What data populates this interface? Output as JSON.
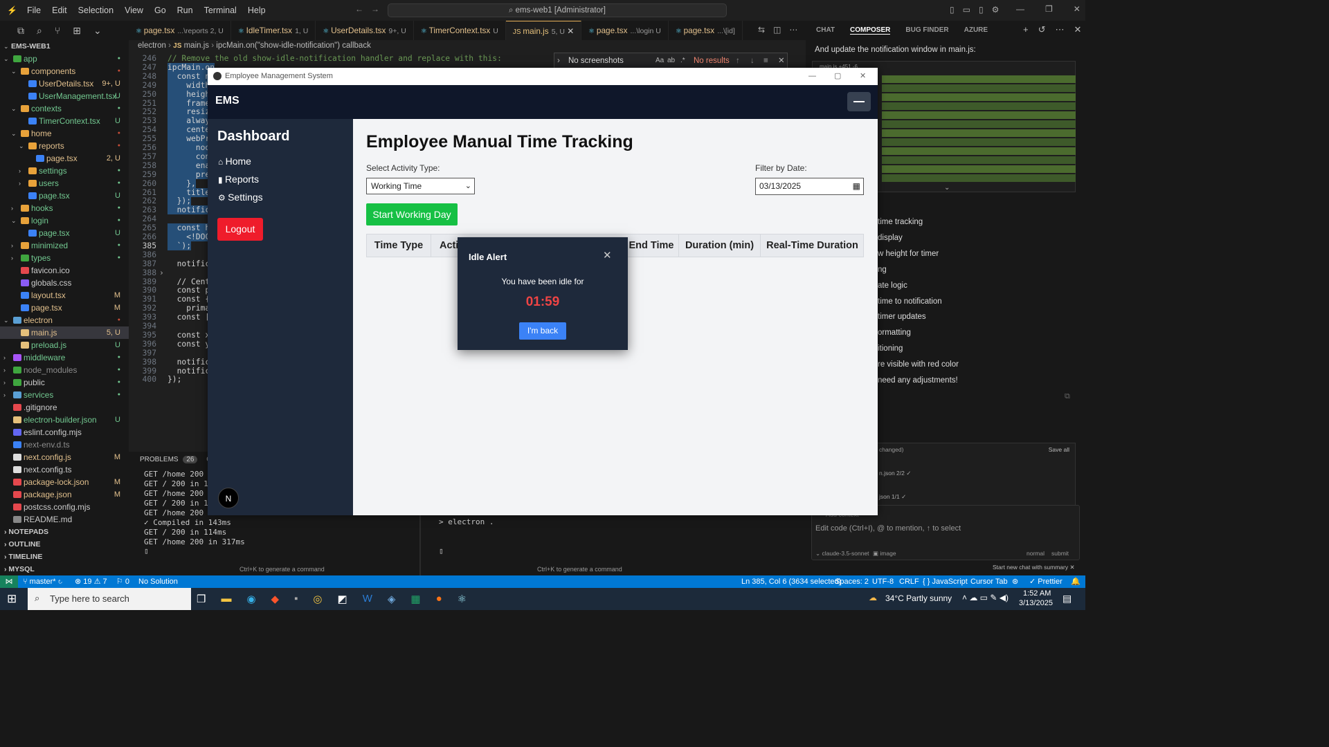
{
  "titlebar": {
    "menus": [
      "File",
      "Edit",
      "Selection",
      "View",
      "Go",
      "Run",
      "Terminal",
      "Help"
    ],
    "command_center": "ems-web1 [Administrator]"
  },
  "explorer": {
    "root": "EMS-WEB1",
    "items": [
      {
        "name": "app",
        "badge": "",
        "color": "#73c991",
        "icon": "#3fa63f",
        "type": "folder"
      },
      {
        "name": "components",
        "badge": "",
        "color": "#e2c08d",
        "icon": "#e8a23a",
        "type": "folder"
      },
      {
        "name": "UserDetails.tsx",
        "badge": "9+, U",
        "color": "#e2c08d",
        "icon": "#3b82f6",
        "type": "file"
      },
      {
        "name": "UserManagement.tsx",
        "badge": "U",
        "color": "#73c991",
        "icon": "#3b82f6",
        "type": "file"
      },
      {
        "name": "contexts",
        "badge": "",
        "color": "#73c991",
        "icon": "#e8a23a",
        "type": "folder"
      },
      {
        "name": "TimerContext.tsx",
        "badge": "U",
        "color": "#73c991",
        "icon": "#3b82f6",
        "type": "file"
      },
      {
        "name": "home",
        "badge": "",
        "color": "#e2c08d",
        "icon": "#e8a23a",
        "type": "folder"
      },
      {
        "name": "reports",
        "badge": "",
        "color": "#e2c08d",
        "icon": "#e8a23a",
        "type": "folder"
      },
      {
        "name": "page.tsx",
        "badge": "2, U",
        "color": "#e2c08d",
        "icon": "#3b82f6",
        "type": "file"
      },
      {
        "name": "settings",
        "badge": "",
        "color": "#73c991",
        "icon": "#e8a23a",
        "type": "folder"
      },
      {
        "name": "users",
        "badge": "",
        "color": "#73c991",
        "icon": "#e8a23a",
        "type": "folder"
      },
      {
        "name": "page.tsx",
        "badge": "U",
        "color": "#73c991",
        "icon": "#3b82f6",
        "type": "file"
      },
      {
        "name": "hooks",
        "badge": "",
        "color": "#73c991",
        "icon": "#e8a23a",
        "type": "folder"
      },
      {
        "name": "login",
        "badge": "",
        "color": "#73c991",
        "icon": "#e8a23a",
        "type": "folder"
      },
      {
        "name": "page.tsx",
        "badge": "U",
        "color": "#73c991",
        "icon": "#3b82f6",
        "type": "file"
      },
      {
        "name": "minimized",
        "badge": "",
        "color": "#73c991",
        "icon": "#e8a23a",
        "type": "folder"
      },
      {
        "name": "types",
        "badge": "",
        "color": "#73c991",
        "icon": "#3fa63f",
        "type": "folder"
      },
      {
        "name": "favicon.ico",
        "badge": "",
        "color": "#ccc",
        "icon": "#e5484d",
        "type": "file"
      },
      {
        "name": "globals.css",
        "badge": "",
        "color": "#ccc",
        "icon": "#8b5cf6",
        "type": "file"
      },
      {
        "name": "layout.tsx",
        "badge": "M",
        "color": "#e2c08d",
        "icon": "#3b82f6",
        "type": "file"
      },
      {
        "name": "page.tsx",
        "badge": "M",
        "color": "#e2c08d",
        "icon": "#3b82f6",
        "type": "file"
      },
      {
        "name": "electron",
        "badge": "",
        "color": "#e2c08d",
        "icon": "#5a9fd4",
        "type": "folder"
      },
      {
        "name": "main.js",
        "badge": "5, U",
        "color": "#e2c08d",
        "icon": "#e5c07b",
        "type": "file"
      },
      {
        "name": "preload.js",
        "badge": "U",
        "color": "#73c991",
        "icon": "#e5c07b",
        "type": "file"
      },
      {
        "name": "middleware",
        "badge": "",
        "color": "#73c991",
        "icon": "#a855f7",
        "type": "folder"
      },
      {
        "name": "node_modules",
        "badge": "",
        "color": "#8c8c8c",
        "icon": "#3fa63f",
        "type": "folder"
      },
      {
        "name": "public",
        "badge": "",
        "color": "#ccc",
        "icon": "#3fa63f",
        "type": "folder"
      },
      {
        "name": "services",
        "badge": "",
        "color": "#73c991",
        "icon": "#5a9fd4",
        "type": "folder"
      },
      {
        "name": ".gitignore",
        "badge": "",
        "color": "#ccc",
        "icon": "#e5484d",
        "type": "file"
      },
      {
        "name": "electron-builder.json",
        "badge": "U",
        "color": "#73c991",
        "icon": "#e5c07b",
        "type": "file"
      },
      {
        "name": "eslint.config.mjs",
        "badge": "",
        "color": "#ccc",
        "icon": "#6366f1",
        "type": "file"
      },
      {
        "name": "next-env.d.ts",
        "badge": "",
        "color": "#8c8c8c",
        "icon": "#3b82f6",
        "type": "file"
      },
      {
        "name": "next.config.js",
        "badge": "M",
        "color": "#e2c08d",
        "icon": "#ddd",
        "type": "file"
      },
      {
        "name": "next.config.ts",
        "badge": "",
        "color": "#ccc",
        "icon": "#ddd",
        "type": "file"
      },
      {
        "name": "package-lock.json",
        "badge": "M",
        "color": "#e2c08d",
        "icon": "#e5484d",
        "type": "file"
      },
      {
        "name": "package.json",
        "badge": "M",
        "color": "#e2c08d",
        "icon": "#e5484d",
        "type": "file"
      },
      {
        "name": "postcss.config.mjs",
        "badge": "",
        "color": "#ccc",
        "icon": "#e5484d",
        "type": "file"
      },
      {
        "name": "README.md",
        "badge": "",
        "color": "#ccc",
        "icon": "#888",
        "type": "file"
      }
    ],
    "sections": [
      "NOTEPADS",
      "OUTLINE",
      "TIMELINE",
      "MYSQL"
    ]
  },
  "tabs": [
    {
      "label": "page.tsx",
      "hint": "...\\reports 2, U"
    },
    {
      "label": "IdleTimer.tsx",
      "hint": "1, U"
    },
    {
      "label": "UserDetails.tsx",
      "hint": "9+, U"
    },
    {
      "label": "TimerContext.tsx",
      "hint": "U"
    },
    {
      "label": "main.js",
      "hint": "5, U"
    },
    {
      "label": "page.tsx",
      "hint": "...\\login U"
    },
    {
      "label": "page.tsx",
      "hint": "...\\[id]"
    }
  ],
  "breadcrumb": [
    "electron",
    "main.js",
    "ipcMain.on(\"show-idle-notification\") callback"
  ],
  "editor": {
    "lines": [
      {
        "n": "246",
        "t": "// Remove the old show-idle-notification handler and replace with this:"
      },
      {
        "n": "247",
        "t": "ipcMain.on"
      },
      {
        "n": "248",
        "t": "  const n"
      },
      {
        "n": "249",
        "t": "    width"
      },
      {
        "n": "250",
        "t": "    heigh"
      },
      {
        "n": "251",
        "t": "    frame"
      },
      {
        "n": "252",
        "t": "    resiz"
      },
      {
        "n": "253",
        "t": "    alway"
      },
      {
        "n": "254",
        "t": "    cente"
      },
      {
        "n": "255",
        "t": "    webPr"
      },
      {
        "n": "256",
        "t": "      nod"
      },
      {
        "n": "257",
        "t": "      con"
      },
      {
        "n": "258",
        "t": "      ena"
      },
      {
        "n": "259",
        "t": "      pre"
      },
      {
        "n": "260",
        "t": "    },"
      },
      {
        "n": "261",
        "t": "    title"
      },
      {
        "n": "262",
        "t": "  });"
      },
      {
        "n": "263",
        "t": "  notifica"
      },
      {
        "n": "264",
        "t": ""
      },
      {
        "n": "265",
        "t": "  const ht"
      },
      {
        "n": "266",
        "t": "    <!DOC"
      },
      {
        "n": "385",
        "t": "  `);"
      },
      {
        "n": "386",
        "t": ""
      },
      {
        "n": "387",
        "t": "  notifica"
      },
      {
        "n": "388",
        "t": ""
      },
      {
        "n": "389",
        "t": "  // Cente"
      },
      {
        "n": "390",
        "t": "  const pr"
      },
      {
        "n": "391",
        "t": "  const {"
      },
      {
        "n": "392",
        "t": "    primar"
      },
      {
        "n": "393",
        "t": "  const [w"
      },
      {
        "n": "394",
        "t": ""
      },
      {
        "n": "395",
        "t": "  const x"
      },
      {
        "n": "396",
        "t": "  const y"
      },
      {
        "n": "397",
        "t": ""
      },
      {
        "n": "398",
        "t": "  notifica"
      },
      {
        "n": "399",
        "t": "  notifica"
      },
      {
        "n": "400",
        "t": "});"
      }
    ]
  },
  "find_widget": {
    "query": "No screenshots",
    "result": "No results",
    "opts": [
      "Aa",
      "ab",
      ".*"
    ]
  },
  "panel": {
    "tabs": [
      "PROBLEMS",
      "26",
      "O"
    ],
    "terminal_left": [
      "GET /home 200 in",
      "GET / 200 in 106",
      "GET /home 200 in",
      "GET / 200 in 112",
      "GET /home 200 in",
      "✓ Compiled in 143ms",
      "GET / 200 in 114ms",
      "GET /home 200 in 317ms"
    ],
    "terminal_right": "> electron .",
    "hint": "Ctrl+K to generate a command"
  },
  "composer": {
    "tabs": [
      "CHAT",
      "COMPOSER",
      "BUG FINDER",
      "AZURE"
    ],
    "intro": "And update the notification window in main.js:",
    "file_chip": "main.js +451 -6",
    "bullets": [
      "time tracking",
      "display",
      "w height for timer",
      "ng",
      "ate logic",
      "time to notification",
      "timer updates",
      "ormatting",
      "itioning",
      "re visible with red color",
      "need any adjustments!"
    ],
    "changed": "changed)",
    "save_all": "Save all",
    "files": [
      "n.json 2/2 ✓",
      "json 1/1 ✓"
    ],
    "add_context": "Add context",
    "input_placeholder": "Edit code (Ctrl+I), @ to mention, ↑ to select",
    "model": "claude-3.5-sonnet",
    "image": "image",
    "mode": "normal",
    "submit": "submit",
    "new_chat": "Start new chat with summary"
  },
  "statusbar": {
    "branch": "master*",
    "errors": "19",
    "warnings": "7",
    "ports": "0",
    "solution": "No Solution",
    "position": "Ln 385, Col 6 (3634 selected)",
    "spaces": "Spaces: 2",
    "encoding": "UTF-8",
    "eol": "CRLF",
    "language": "JavaScript",
    "cursor_tab": "Cursor Tab",
    "prettier": "Prettier"
  },
  "ems": {
    "window_title": "Employee Management System",
    "brand": "EMS",
    "sidebar_title": "Dashboard",
    "nav": [
      {
        "label": "Home",
        "icon": "home-icon"
      },
      {
        "label": "Reports",
        "icon": "bar-chart-icon"
      },
      {
        "label": "Settings",
        "icon": "gear-icon"
      }
    ],
    "logout": "Logout",
    "page_title": "Employee Manual Time Tracking",
    "activity_label": "Select Activity Type:",
    "activity_value": "Working Time",
    "date_label": "Filter by Date:",
    "date_value": "03/13/2025",
    "start_button": "Start Working Day",
    "columns": [
      "Time Type",
      "Acti",
      "End Time",
      "Duration (min)",
      "Real-Time Duration"
    ],
    "avatar": "N",
    "colors": {
      "accent_green": "#16c044",
      "logout_red": "#ef1c2b",
      "dark": "#0f172a",
      "side": "#1e293b",
      "blue": "#3b82f6",
      "timer_red": "#ef4444"
    }
  },
  "idle_modal": {
    "title": "Idle Alert",
    "message": "You have been idle for",
    "timer": "01:59",
    "button": "I'm back"
  },
  "taskbar": {
    "search_placeholder": "Type here to search",
    "weather": "34°C  Partly sunny",
    "time": "1:52 AM",
    "date": "3/13/2025"
  }
}
